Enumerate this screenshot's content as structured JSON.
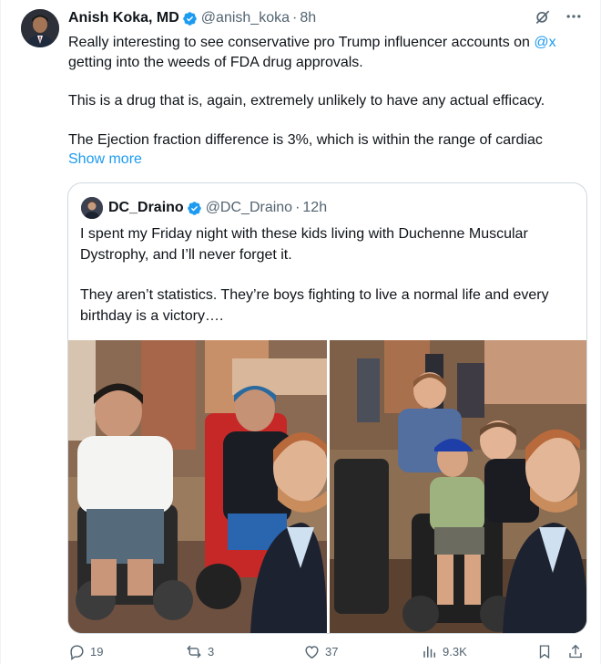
{
  "post": {
    "author_name": "Anish Koka, MD",
    "handle": "@anish_koka",
    "separator": "·",
    "time": "8h",
    "text_line1": "Really interesting to see conservative pro Trump influencer accounts on ",
    "mention": "@x",
    "text_line2": "getting into the weeds of FDA drug approvals.",
    "text_para2": "This is a drug that is, again, extremely unlikely to have any actual efficacy.",
    "text_para3": "The Ejection fraction difference is 3%, which is within the range of cardiac",
    "show_more": "Show more",
    "header_icons": [
      "grok-icon",
      "more-icon"
    ]
  },
  "quote": {
    "author_name": "DC_Draino",
    "handle": "@DC_Draino",
    "separator": "·",
    "time": "12h",
    "text_para1": "I spent my Friday night with these kids living with Duchenne Muscular Dystrophy, and I’ll never forget it.",
    "text_para2": "They aren’t statistics. They’re boys fighting to live a normal life and every birthday is a victory…."
  },
  "actions": {
    "replies": "19",
    "reposts": "3",
    "likes": "37",
    "views": "9.3K"
  },
  "colors": {
    "accent": "#1d9bf0",
    "text": "#0f1419",
    "muted": "#536471",
    "border": "#cfd9de"
  }
}
